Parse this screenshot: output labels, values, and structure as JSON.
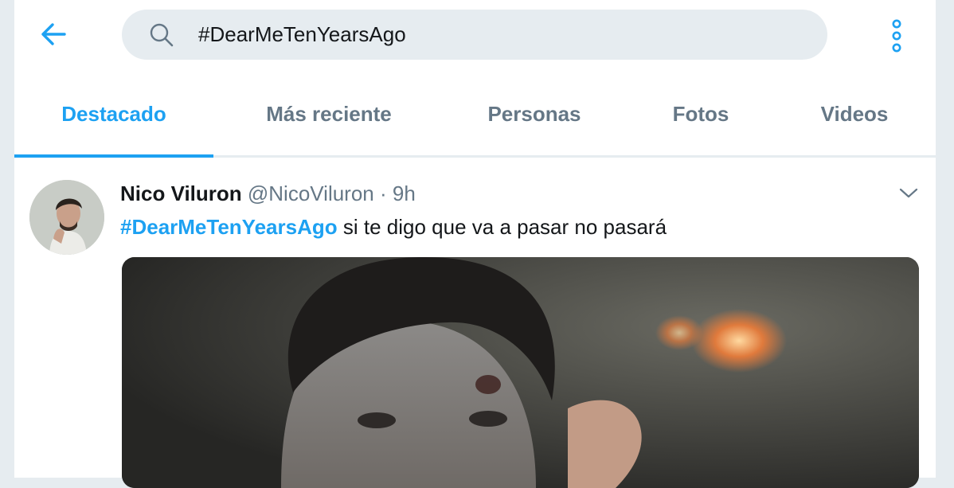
{
  "search": {
    "value": "#DearMeTenYearsAgo"
  },
  "tabs": [
    {
      "label": "Destacado",
      "active": true
    },
    {
      "label": "Más reciente",
      "active": false
    },
    {
      "label": "Personas",
      "active": false
    },
    {
      "label": "Fotos",
      "active": false
    },
    {
      "label": "Videos",
      "active": false
    }
  ],
  "tweet": {
    "name": "Nico Viluron",
    "handle": "@NicoViluron",
    "separator": "·",
    "time": "9h",
    "hashtag": "#DearMeTenYearsAgo",
    "text": " si te digo que va a pasar no pasará"
  },
  "colors": {
    "accent": "#1da1f2",
    "muted": "#657786",
    "search_bg": "#e6ecf0"
  },
  "icons": {
    "back": "arrow-left-icon",
    "search": "search-icon",
    "more": "more-vertical-icon",
    "caret": "chevron-down-icon"
  }
}
